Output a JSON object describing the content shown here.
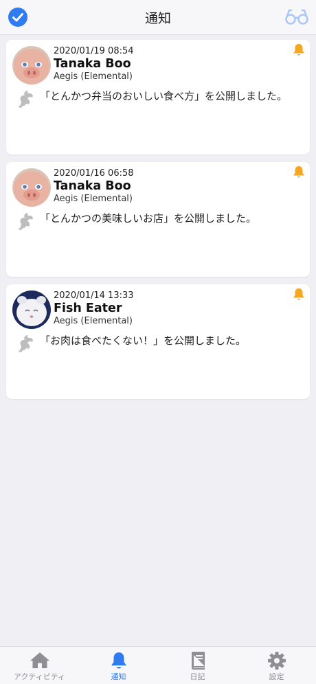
{
  "header": {
    "title": "通知"
  },
  "colors": {
    "accent": "#2f7bf0",
    "bell": "#f5a623",
    "inactive": "#8e8e93",
    "background": "#efeff4"
  },
  "notifications": [
    {
      "date": "2020/01/19 08:54",
      "name": "Tanaka Boo",
      "server": "Aegis (Elemental)",
      "message": "「とんかつ弁当のおいしい食べ方」を公開しました。",
      "avatar": "pig-avatar"
    },
    {
      "date": "2020/01/16 06:58",
      "name": "Tanaka Boo",
      "server": "Aegis (Elemental)",
      "message": "「とんかつの美味しいお店」を公開しました。",
      "avatar": "pig-avatar"
    },
    {
      "date": "2020/01/14 13:33",
      "name": "Fish Eater",
      "server": "Aegis (Elemental)",
      "message": "「お肉は食べたくない！」を公開しました。",
      "avatar": "moogle-avatar"
    }
  ],
  "tabs": [
    {
      "label": "アクティビティ",
      "icon": "home-icon"
    },
    {
      "label": "通知",
      "icon": "bell-icon",
      "active": true
    },
    {
      "label": "日記",
      "icon": "book-icon"
    },
    {
      "label": "設定",
      "icon": "gear-icon"
    }
  ]
}
